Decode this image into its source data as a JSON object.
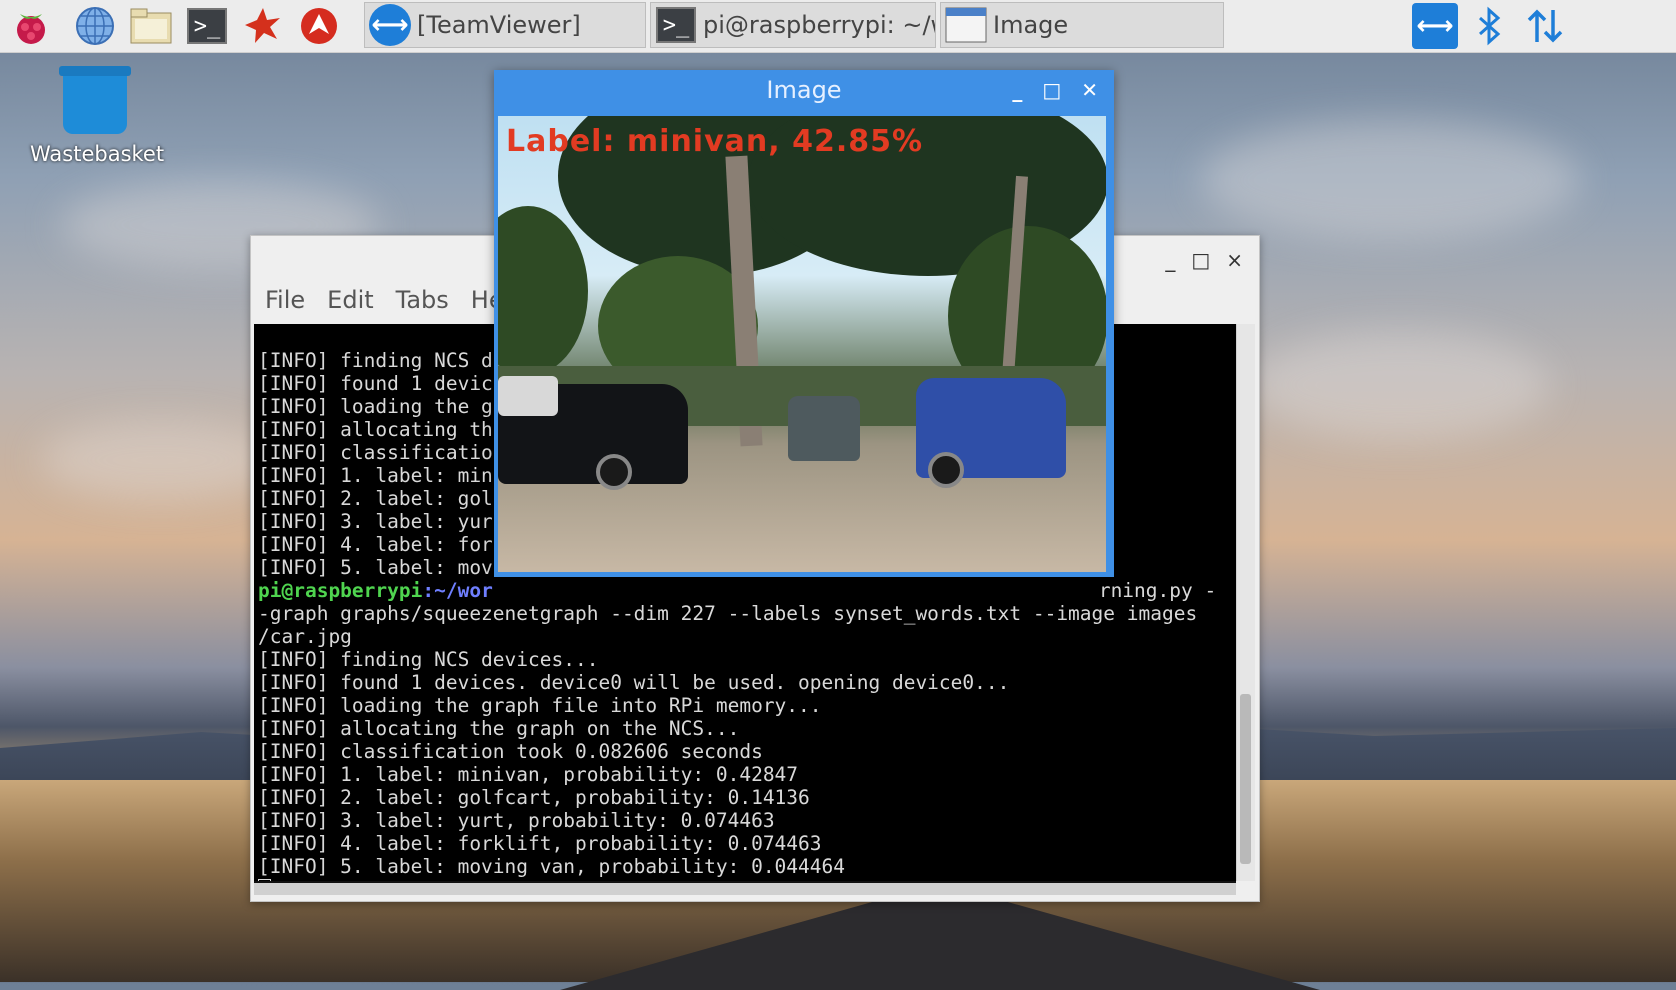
{
  "taskbar": {
    "launchers": [
      {
        "name": "raspberry-menu-icon"
      },
      {
        "name": "web-browser-icon"
      },
      {
        "name": "file-manager-icon"
      },
      {
        "name": "terminal-icon"
      },
      {
        "name": "mathematica-icon"
      },
      {
        "name": "wolfram-icon"
      }
    ],
    "tasks": [
      {
        "label": "[TeamViewer]",
        "icon": "teamviewer-icon"
      },
      {
        "label": "pi@raspberrypi: ~/wo...",
        "icon": "terminal-icon"
      },
      {
        "label": "Image",
        "icon": "window-icon"
      }
    ],
    "tray": [
      "teamviewer-icon",
      "bluetooth-icon",
      "network-arrows-icon"
    ]
  },
  "desktop": {
    "wastebasket_label": "Wastebasket"
  },
  "terminal": {
    "menu": [
      "File",
      "Edit",
      "Tabs",
      "Hel"
    ],
    "lines_top": [
      "[INFO] finding NCS d",
      "[INFO] found 1 devic",
      "[INFO] loading the g",
      "[INFO] allocating th",
      "[INFO] classificatio",
      "[INFO] 1. label: min",
      "[INFO] 2. label: gol",
      "[INFO] 3. label: yur",
      "[INFO] 4. label: for",
      "[INFO] 5. label: mov"
    ],
    "prompt_user": "pi@raspberrypi",
    "prompt_path": ":~/wor",
    "prompt_tail": "rning.py -",
    "lines_bottom": [
      "-graph graphs/squeezenetgraph --dim 227 --labels synset_words.txt --image images",
      "/car.jpg",
      "[INFO] finding NCS devices...",
      "[INFO] found 1 devices. device0 will be used. opening device0...",
      "[INFO] loading the graph file into RPi memory...",
      "[INFO] allocating the graph on the NCS...",
      "[INFO] classification took 0.082606 seconds",
      "[INFO] 1. label: minivan, probability: 0.42847",
      "[INFO] 2. label: golfcart, probability: 0.14136",
      "[INFO] 3. label: yurt, probability: 0.074463",
      "[INFO] 4. label: forklift, probability: 0.074463",
      "[INFO] 5. label: moving van, probability: 0.044464"
    ],
    "buttons": {
      "minimize": "_",
      "maximize": "□",
      "close": "×"
    }
  },
  "image_window": {
    "title": "Image",
    "overlay_label": "Label: minivan, 42.85%",
    "buttons": {
      "minimize": "_",
      "maximize": "□",
      "close": "✕"
    }
  },
  "colors": {
    "title_blue": "#3f90e6",
    "label_red": "#e23b22",
    "prompt_green": "#4fd44f",
    "prompt_blue": "#6f7fff"
  }
}
